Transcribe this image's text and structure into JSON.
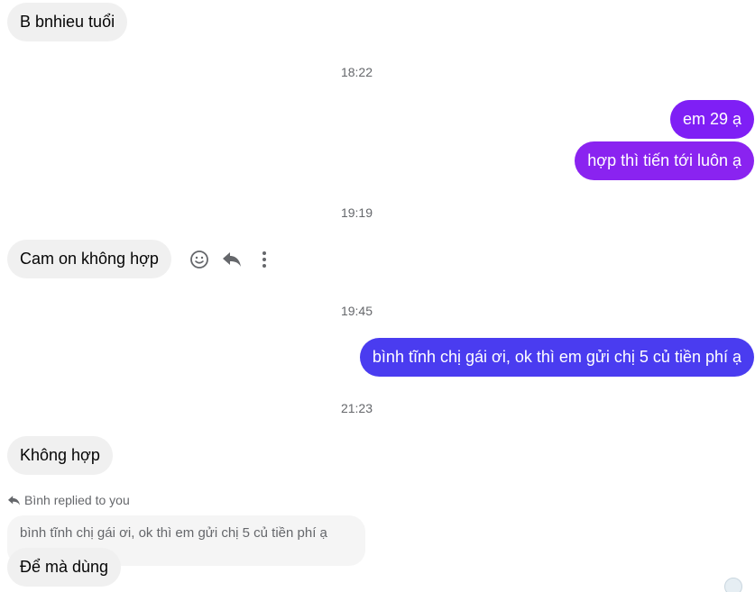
{
  "colors": {
    "incoming_bg": "#f0f0f0",
    "outgoing_purple": "#7f1ff5",
    "outgoing_purple2": "#8a23f0",
    "outgoing_blue": "#4a3cf0",
    "timestamp": "#65676b"
  },
  "messages": {
    "m1": "B bnhieu tuổi",
    "t1": "18:22",
    "m2": "em 29 ạ",
    "m3": "hợp thì tiến tới luôn ạ",
    "t2": "19:19",
    "m4": "Cam on không hợp",
    "t3": "19:45",
    "m5": "bình tĩnh chị gái ơi, ok thì em gửi chị 5 củ tiền phí ạ",
    "t4": "21:23",
    "m6": "Không hợp",
    "reply_label": "Bình replied to you",
    "reply_quote": "bình tĩnh chị gái ơi, ok thì em gửi chị 5 củ tiền phí ạ",
    "m7": "Để mà dùng"
  },
  "icons": {
    "react": "smiley-icon",
    "reply": "reply-arrow-icon",
    "more": "more-vertical-icon",
    "reply_indicator": "reply-arrow-icon"
  }
}
